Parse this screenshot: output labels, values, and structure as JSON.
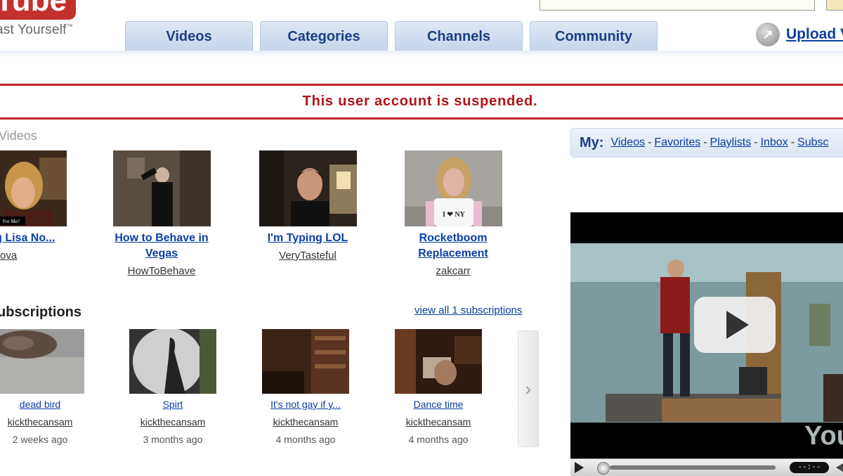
{
  "header": {
    "logo_text": "Tube",
    "tagline": "ast Yourself",
    "tagline_tm": "™",
    "upload_label": "Upload V"
  },
  "nav": {
    "tabs": [
      {
        "label": "Videos"
      },
      {
        "label": "Categories"
      },
      {
        "label": "Channels"
      },
      {
        "label": "Community"
      }
    ]
  },
  "alert": {
    "message": "This user account is suspended."
  },
  "videos_section": {
    "label": "Videos",
    "items": [
      {
        "title_line1": "cing Lisa No...",
        "title_line2": "",
        "user": "isaNova",
        "thumb_caption": "For Me?"
      },
      {
        "title_line1": "How to Behave in",
        "title_line2": "Vegas",
        "user": "HowToBehave"
      },
      {
        "title_line1": "I'm Typing LOL",
        "title_line2": "",
        "user": "VeryTasteful"
      },
      {
        "title_line1": "Rocketboom",
        "title_line2": "Replacement",
        "user": "zakcarr",
        "shirt_text": "I ❤ NY"
      }
    ]
  },
  "subscriptions_section": {
    "title": "ubscriptions",
    "view_all": "view all 1 subscriptions",
    "items": [
      {
        "title": "dead bird",
        "user": "kickthecansam",
        "age": "2 weeks ago"
      },
      {
        "title": "Spirt",
        "user": "kickthecansam",
        "age": "3 months ago"
      },
      {
        "title": "It's not gay if y...",
        "user": "kickthecansam",
        "age": "4 months ago"
      },
      {
        "title": "Dance time",
        "user": "kickthecansam",
        "age": "4 months ago"
      }
    ],
    "next_arrow": "›"
  },
  "my_bar": {
    "label": "My:",
    "links": [
      "Videos",
      "Favorites",
      "Playlists",
      "Inbox",
      "Subsc"
    ],
    "separator": "-"
  },
  "player": {
    "watermark": "You",
    "time_display": "--:--"
  },
  "colors": {
    "brand_red": "#c4302b",
    "alert_red": "#b31218",
    "link_blue": "#0b3ea3",
    "tab_text": "#1c3e84"
  }
}
